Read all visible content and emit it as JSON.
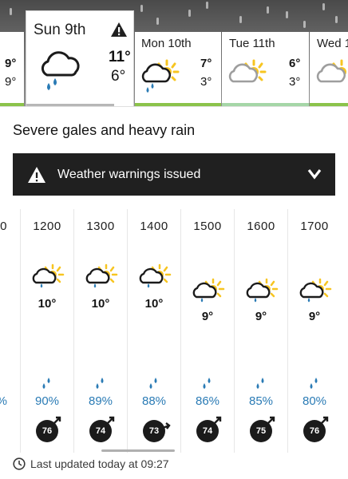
{
  "days": [
    {
      "name": "",
      "hi": "9°",
      "lo": "9°",
      "bar": "#8bc34a"
    },
    {
      "name": "Sun 9th",
      "hi": "11°",
      "lo": "6°",
      "bar": "#b7b7b7",
      "warning": true,
      "icon": "rain-cloud-icon"
    },
    {
      "name": "Mon 10th",
      "hi": "7°",
      "lo": "3°",
      "bar": "#8bc34a",
      "icon": "sun-cloud-rain-icon"
    },
    {
      "name": "Tue 11th",
      "hi": "6°",
      "lo": "3°",
      "bar": "#a5d6a7",
      "icon": "sun-cloud-icon"
    },
    {
      "name": "Wed 1",
      "hi": "",
      "lo": "",
      "bar": "#8bc34a",
      "icon": "sun-cloud-icon"
    }
  ],
  "summary": "Severe gales and heavy rain",
  "warning_banner": {
    "label": "Weather warnings issued"
  },
  "partial_hour": {
    "time": "0",
    "rain": "%"
  },
  "hours": [
    {
      "time": "1200",
      "temp": "10°",
      "rain": "90%",
      "wind": "76"
    },
    {
      "time": "1300",
      "temp": "10°",
      "rain": "89%",
      "wind": "74"
    },
    {
      "time": "1400",
      "temp": "10°",
      "rain": "88%",
      "wind": "73"
    },
    {
      "time": "1500",
      "temp": "9°",
      "rain": "86%",
      "wind": "74"
    },
    {
      "time": "1600",
      "temp": "9°",
      "rain": "85%",
      "wind": "75"
    },
    {
      "time": "1700",
      "temp": "9°",
      "rain": "80%",
      "wind": "76"
    }
  ],
  "footer": {
    "last_updated": "Last updated today at 09:27"
  },
  "colors": {
    "accent_green": "#8bc34a",
    "rain_blue": "#2a7bb5",
    "sun_yellow": "#f7c521",
    "banner": "#202020"
  }
}
